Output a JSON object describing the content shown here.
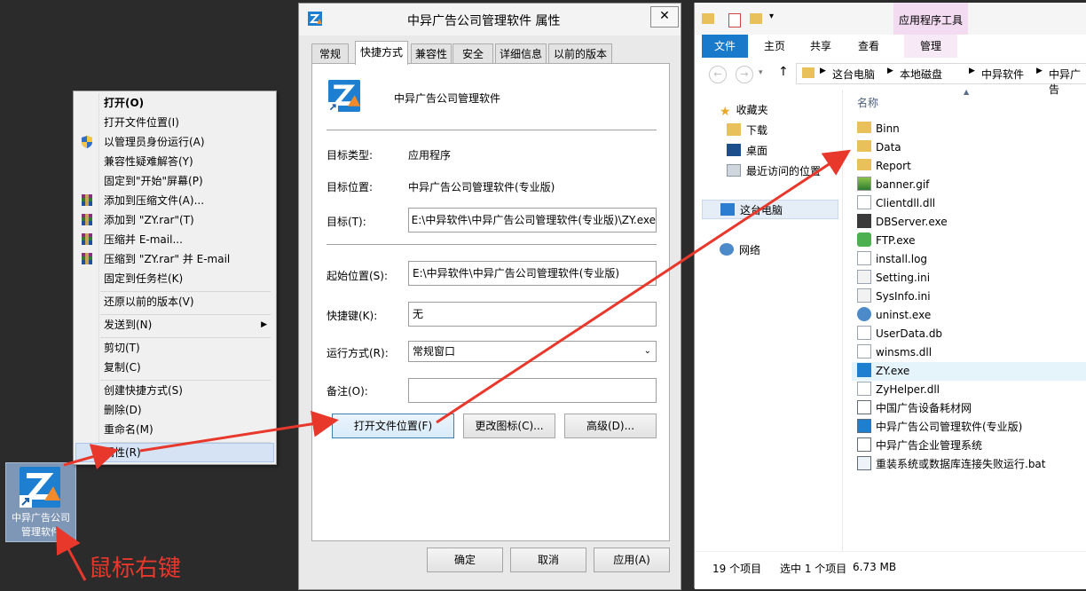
{
  "desktop_icon": {
    "label_line1": "中异广告公司",
    "label_line2": "管理软件"
  },
  "annotation": {
    "right_click": "鼠标右键"
  },
  "context_menu": {
    "items": [
      {
        "label": "打开(O)"
      },
      {
        "label": "打开文件位置(I)"
      },
      {
        "label": "以管理员身份运行(A)"
      },
      {
        "label": "兼容性疑难解答(Y)"
      },
      {
        "label": "固定到\"开始\"屏幕(P)"
      },
      {
        "label": "添加到压缩文件(A)..."
      },
      {
        "label": "添加到 \"ZY.rar\"(T)"
      },
      {
        "label": "压缩并 E-mail..."
      },
      {
        "label": "压缩到 \"ZY.rar\" 并 E-mail"
      },
      {
        "label": "固定到任务栏(K)"
      },
      {
        "label": "还原以前的版本(V)"
      },
      {
        "label": "发送到(N)"
      },
      {
        "label": "剪切(T)"
      },
      {
        "label": "复制(C)"
      },
      {
        "label": "创建快捷方式(S)"
      },
      {
        "label": "删除(D)"
      },
      {
        "label": "重命名(M)"
      },
      {
        "label": "属性(R)"
      }
    ]
  },
  "properties_dialog": {
    "title": "中异广告公司管理软件 属性",
    "close_label": "✕",
    "tabs": [
      "常规",
      "快捷方式",
      "兼容性",
      "安全",
      "详细信息",
      "以前的版本"
    ],
    "name": "中异广告公司管理软件",
    "target_type_label": "目标类型:",
    "target_type_value": "应用程序",
    "target_location_label": "目标位置:",
    "target_location_value": "中异广告公司管理软件(专业版)",
    "target_label": "目标(T):",
    "target_value": "E:\\中异软件\\中异广告公司管理软件(专业版)\\ZY.exe",
    "start_in_label": "起始位置(S):",
    "start_in_value": "E:\\中异软件\\中异广告公司管理软件(专业版)",
    "hotkey_label": "快捷键(K):",
    "hotkey_value": "无",
    "run_label": "运行方式(R):",
    "run_value": "常规窗口",
    "comment_label": "备注(O):",
    "comment_value": "",
    "btn_open_location": "打开文件位置(F)",
    "btn_change_icon": "更改图标(C)...",
    "btn_advanced": "高级(D)...",
    "btn_ok": "确定",
    "btn_cancel": "取消",
    "btn_apply": "应用(A)"
  },
  "explorer": {
    "contextual_tab": "应用程序工具",
    "ribbon_tabs": [
      "文件",
      "主页",
      "共享",
      "查看",
      "管理"
    ],
    "breadcrumb": [
      "这台电脑",
      "本地磁盘",
      "中异软件",
      "中异广告"
    ],
    "nav": {
      "favorites": "收藏夹",
      "downloads": "下载",
      "desktop": "桌面",
      "recent": "最近访问的位置",
      "this_pc": "这台电脑",
      "network": "网络"
    },
    "column_name": "名称",
    "files": [
      {
        "name": "Binn",
        "icon": "folder-icon"
      },
      {
        "name": "Data",
        "icon": "folder-icon"
      },
      {
        "name": "Report",
        "icon": "folder-icon"
      },
      {
        "name": "banner.gif",
        "icon": "image-icon"
      },
      {
        "name": "Clientdll.dll",
        "icon": "dll-icon"
      },
      {
        "name": "DBServer.exe",
        "icon": "exe-icon"
      },
      {
        "name": "FTP.exe",
        "icon": "exe-icon"
      },
      {
        "name": "install.log",
        "icon": "text-file-icon"
      },
      {
        "name": "Setting.ini",
        "icon": "ini-icon"
      },
      {
        "name": "SysInfo.ini",
        "icon": "ini-icon"
      },
      {
        "name": "uninst.exe",
        "icon": "exe-icon"
      },
      {
        "name": "UserData.db",
        "icon": "db-icon"
      },
      {
        "name": "winsms.dll",
        "icon": "dll-icon"
      },
      {
        "name": "ZY.exe",
        "icon": "app-icon"
      },
      {
        "name": "ZyHelper.dll",
        "icon": "dll-icon"
      },
      {
        "name": "中国广告设备耗材网",
        "icon": "shortcut-icon"
      },
      {
        "name": "中异广告公司管理软件(专业版)",
        "icon": "shortcut-icon"
      },
      {
        "name": "中异广告企业管理系统",
        "icon": "shortcut-icon"
      },
      {
        "name": "重装系统或数据库连接失败运行.bat",
        "icon": "bat-icon"
      }
    ],
    "status_count": "19 个项目",
    "status_selected": "选中 1 个项目",
    "status_size": "6.73 MB"
  },
  "colors": {
    "accent": "#1979ca",
    "arrow": "#e8382c",
    "selection": "#e5f3fb"
  }
}
